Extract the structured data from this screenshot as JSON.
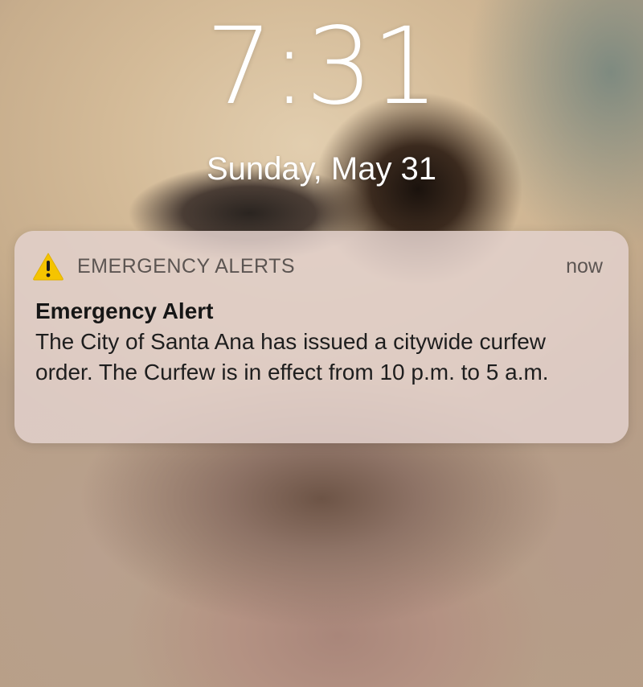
{
  "lock_screen": {
    "time": "7:31",
    "date": "Sunday, May 31"
  },
  "notification": {
    "icon": "warning-triangle-icon",
    "icon_color": "#f5c400",
    "app_name": "EMERGENCY ALERTS",
    "time_ago": "now",
    "title": "Emergency Alert",
    "body": "The City of Santa Ana has issued a citywide curfew order. The Curfew is in effect from 10 p.m. to 5 a.m."
  }
}
